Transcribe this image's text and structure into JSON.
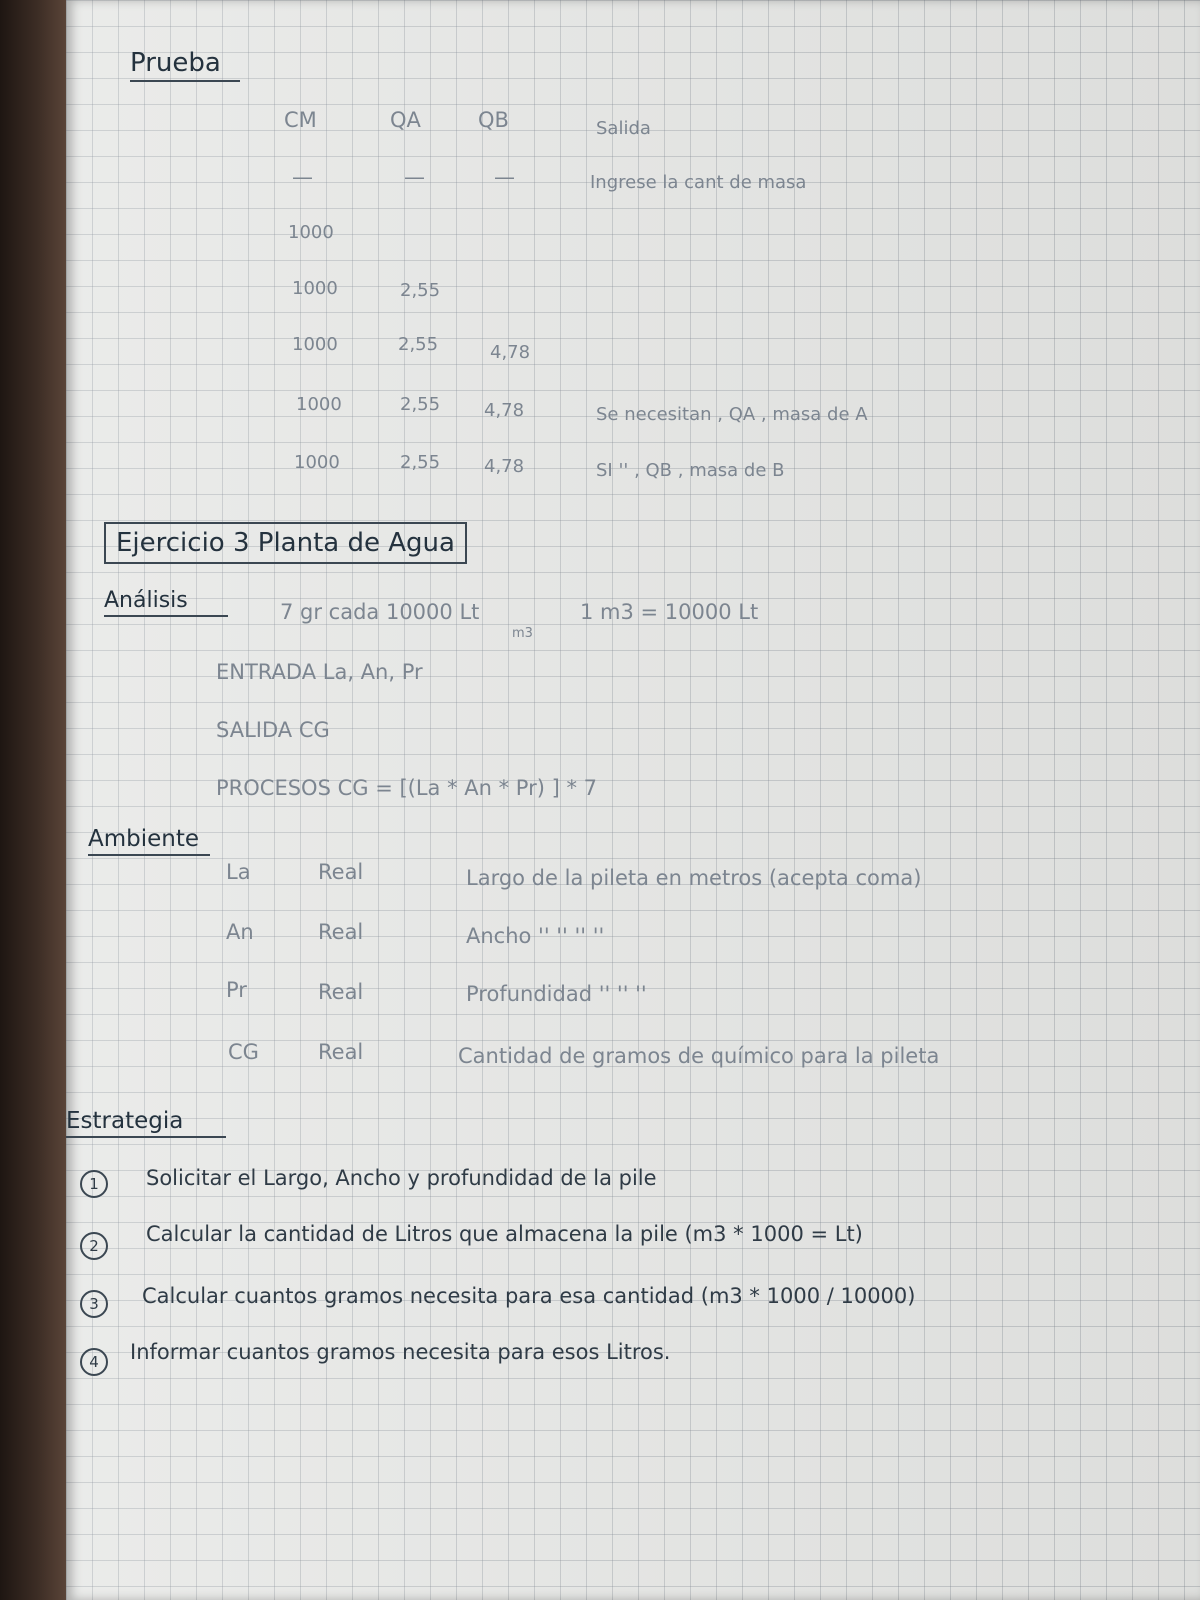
{
  "prueba": {
    "title": "Prueba",
    "headers": [
      "CM",
      "QA",
      "QB",
      "Salida"
    ],
    "rows": [
      [
        "—",
        "—",
        "—",
        "Ingrese la cant de masa"
      ],
      [
        "1000",
        "",
        "",
        ""
      ],
      [
        "1000",
        "2,55",
        "",
        ""
      ],
      [
        "1000",
        "2,55",
        "4,78",
        ""
      ],
      [
        "1000",
        "2,55",
        "4,78",
        "Se necesitan , QA , masa de A"
      ],
      [
        "1000",
        "2,55",
        "4,78",
        "SI  ''  , QB , masa de B"
      ]
    ]
  },
  "ejercicio": {
    "title": "Ejercicio 3 Planta de Agua"
  },
  "analisis": {
    "title": "Análisis",
    "note1": "7 gr cada 10000 Lt",
    "note1_sub": "m3",
    "note2": "1 m3 = 10000 Lt",
    "entrada": "ENTRADA  La, An, Pr",
    "salida": "SALIDA  CG",
    "procesos": "PROCESOS   CG = [(La * An * Pr)        ] * 7"
  },
  "ambiente": {
    "title": "Ambiente",
    "rows": [
      {
        "var": "La",
        "type": "Real",
        "desc": "Largo de la pileta en metros (acepta coma)"
      },
      {
        "var": "An",
        "type": "Real",
        "desc": "Ancho  ''   ''          ''    ''"
      },
      {
        "var": "Pr",
        "type": "Real",
        "desc": "Profundidad  ''          ''      ''"
      },
      {
        "var": "CG",
        "type": "Real",
        "desc": "Cantidad de gramos de químico para la pileta"
      }
    ]
  },
  "estrategia": {
    "title": "Estrategia",
    "steps": [
      {
        "n": "1",
        "text": "Solicitar el Largo, Ancho y profundidad de la pile"
      },
      {
        "n": "2",
        "text": "Calcular la cantidad de Litros que almacena la pile (m3 * 1000 = Lt)"
      },
      {
        "n": "3",
        "text": "Calcular cuantos gramos necesita para esa cantidad (m3 * 1000 / 10000)"
      },
      {
        "n": "4",
        "text": "Informar cuantos gramos necesita para esos Litros."
      }
    ]
  }
}
